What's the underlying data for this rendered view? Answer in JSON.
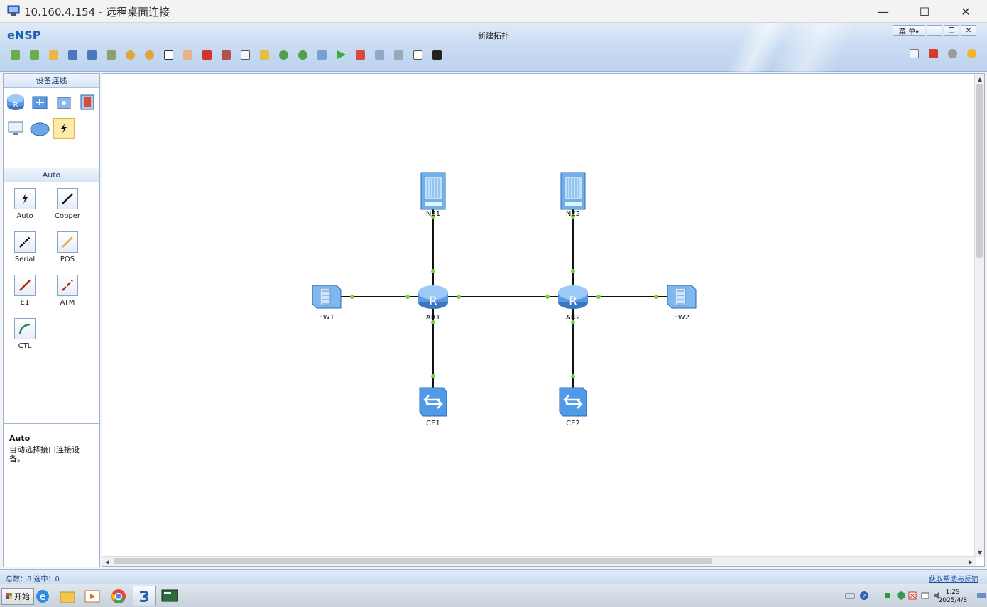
{
  "rdp": {
    "title": "10.160.4.154 - 远程桌面连接",
    "icon": "remote-desktop-icon"
  },
  "app": {
    "logo": "eNSP",
    "document_title": "新建拓扑",
    "menu_label": "菜 单▾",
    "brand_color": "#1f5fae"
  },
  "left_panel": {
    "devices_title": "设备连线",
    "devices": [
      "router-icon",
      "switch-icon",
      "wireless-icon",
      "firewall-icon",
      "pc-icon",
      "cloud-icon",
      "connection-icon"
    ],
    "links_title": "Auto",
    "links": [
      {
        "label": "Auto",
        "color": "#111111"
      },
      {
        "label": "Copper",
        "color": "#111111"
      },
      {
        "label": "Serial",
        "color": "#111111"
      },
      {
        "label": "POS",
        "color": "#f0a040"
      },
      {
        "label": "E1",
        "color": "#b02a10"
      },
      {
        "label": "ATM",
        "color": "#b02a10"
      },
      {
        "label": "CTL",
        "color": "#2e8b4a"
      }
    ],
    "description_title": "Auto",
    "description_text": "自动选择接口连接设备。"
  },
  "topology": {
    "nodes": [
      {
        "id": "NE1",
        "label": "NE1",
        "type": "ne-router"
      },
      {
        "id": "NE2",
        "label": "NE2",
        "type": "ne-router"
      },
      {
        "id": "FW1",
        "label": "FW1",
        "type": "firewall"
      },
      {
        "id": "AR1",
        "label": "AR1",
        "type": "router"
      },
      {
        "id": "AR2",
        "label": "AR2",
        "type": "router"
      },
      {
        "id": "FW2",
        "label": "FW2",
        "type": "firewall"
      },
      {
        "id": "CE1",
        "label": "CE1",
        "type": "switch"
      },
      {
        "id": "CE2",
        "label": "CE2",
        "type": "switch"
      }
    ],
    "links": [
      [
        "NE1",
        "AR1"
      ],
      [
        "NE2",
        "AR2"
      ],
      [
        "FW1",
        "AR1"
      ],
      [
        "AR1",
        "AR2"
      ],
      [
        "AR2",
        "FW2"
      ],
      [
        "AR1",
        "CE1"
      ],
      [
        "AR2",
        "CE2"
      ]
    ],
    "link_status_color": "#7fcf3a"
  },
  "status": {
    "summary": "总数：8  选中：0",
    "help_link": "获取帮助与反馈"
  },
  "taskbar": {
    "start_label": "开始",
    "time": "1:29",
    "date": "2025/4/8"
  }
}
